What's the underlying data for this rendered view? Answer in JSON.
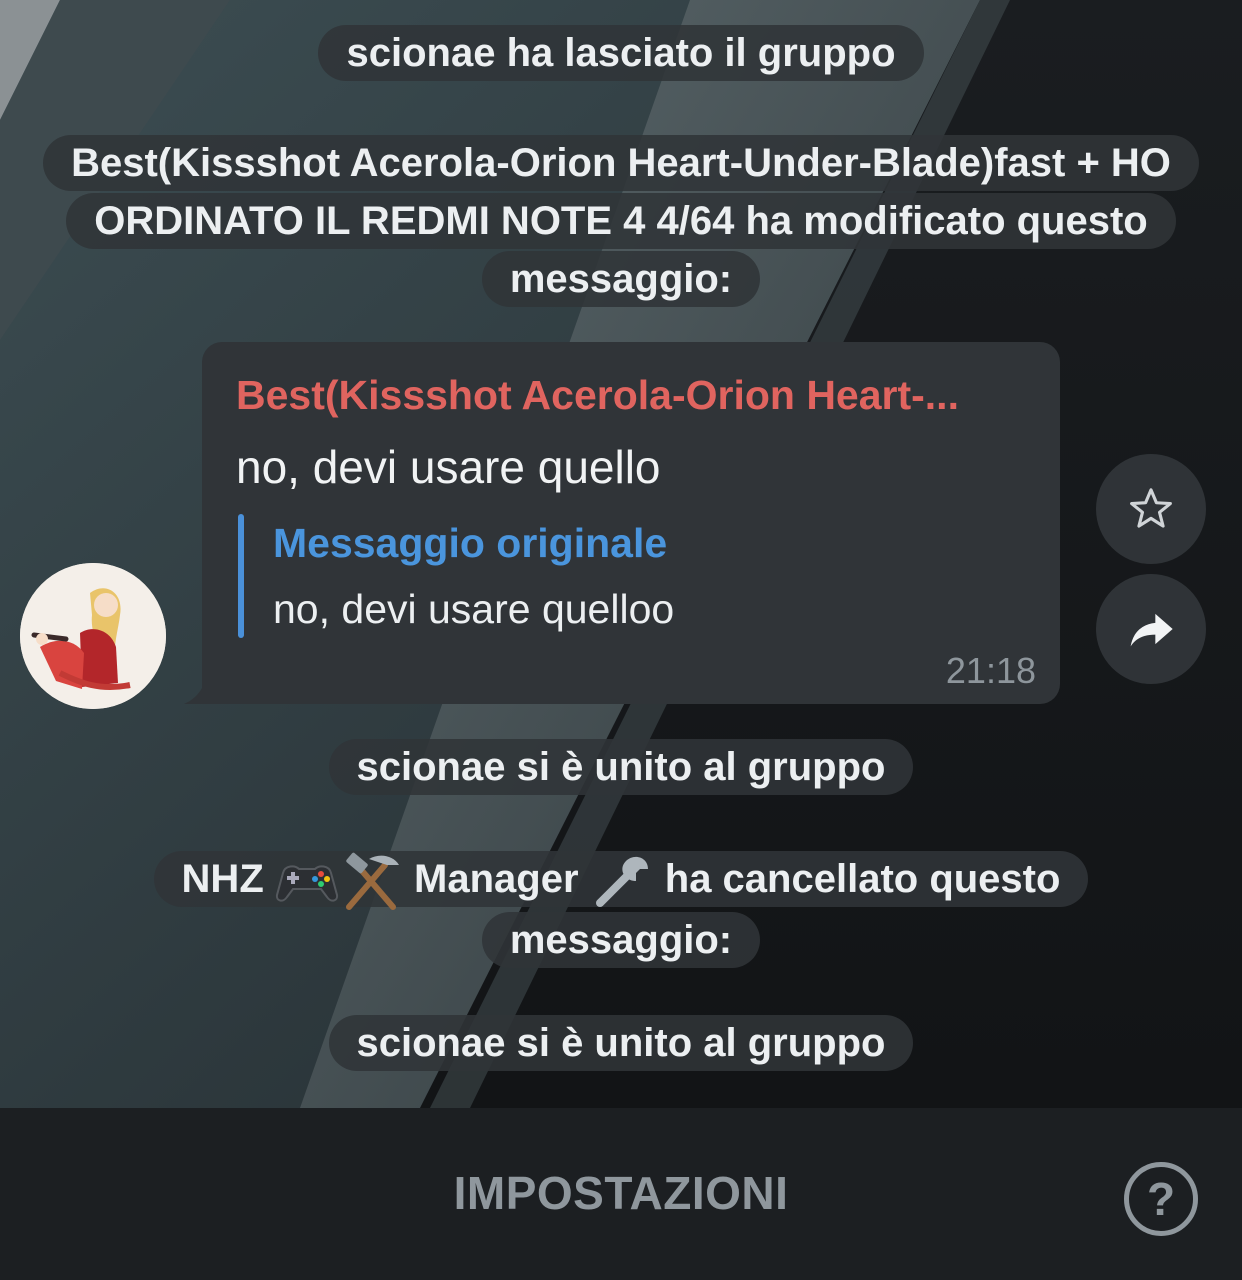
{
  "service_messages": {
    "left_group": "scionae ha lasciato il gruppo",
    "edited_notice": "Best(Kissshot Acerola-Orion Heart-Under-Blade)fast + HO ORDINATO IL REDMI NOTE 4 4/64 ha modificato questo messaggio:",
    "joined_1": "scionae si è unito al gruppo",
    "deleted_notice": {
      "prefix": "NHZ",
      "emoji_1": "gamepad-icon",
      "emoji_2": "hammer-and-pick-icon",
      "middle": "Manager",
      "emoji_3": "wrench-icon",
      "suffix": "ha cancellato questo messaggio:"
    },
    "joined_2": "scionae si è unito al gruppo"
  },
  "message": {
    "sender": "Best(Kissshot Acerola-Orion Heart-...",
    "text": "no, devi usare quello",
    "reply_title": "Messaggio originale",
    "reply_text": "no, devi usare quelloo",
    "time": "21:18"
  },
  "side_buttons": [
    "star-icon",
    "share-icon"
  ],
  "bottom_bar": {
    "settings_label": "IMPOSTAZIONI",
    "help_label": "?"
  },
  "colors": {
    "sender_name": "#e0645f",
    "reply_accent": "#4a90d9",
    "bubble": "#303438",
    "bottom_bar": "#1c1f22"
  }
}
